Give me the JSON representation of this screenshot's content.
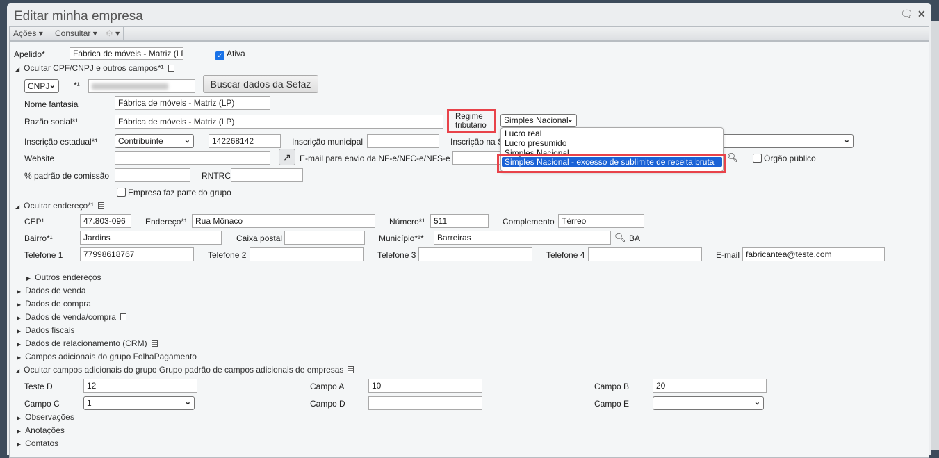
{
  "window": {
    "title": "Editar minha empresa"
  },
  "toolbar": {
    "acoes": "Ações",
    "consultar": "Consultar"
  },
  "form": {
    "apelido_label": "Apelido*",
    "apelido_value": "Fábrica de móveis - Matriz (LP",
    "ativa_label": "Ativa",
    "sec_cpf": "Ocultar CPF/CNPJ e outros campos*¹",
    "doc_type": "CNPJ",
    "doc_req": "*¹",
    "buscar_sefaz": "Buscar dados da Sefaz",
    "nome_fantasia_label": "Nome fantasia",
    "nome_fantasia_value": "Fábrica de móveis - Matriz (LP)",
    "razao_social_label": "Razão social*¹",
    "razao_social_value": "Fábrica de móveis - Matriz (LP)",
    "regime_label": "Regime tributário",
    "regime_value": "Simples Nacional",
    "ie_label": "Inscrição estadual*¹",
    "ie_type": "Contribuinte",
    "ie_value": "142268142",
    "im_label": "Inscrição municipal",
    "insc_s_label": "Inscrição na S",
    "website_label": "Website",
    "email_nfe_label": "E-mail para envio da NF-e/NFC-e/NFS-e",
    "orgao_publico_label": "Órgão público",
    "comissao_label": "% padrão de comissão",
    "rntrc_label": "RNTRC",
    "grupo_label": "Empresa faz parte do grupo"
  },
  "regime_options": [
    "Lucro real",
    "Lucro presumido",
    "Simples Nacional",
    "Simples Nacional - excesso de sublimite de receita bruta"
  ],
  "address": {
    "sec": "Ocultar endereço*¹",
    "cep_label": "CEP¹",
    "cep": "47.803-096",
    "endereco_label": "Endereço*¹",
    "endereco": "Rua Mônaco",
    "numero_label": "Número*¹",
    "numero": "511",
    "complemento_label": "Complemento",
    "complemento": "Térreo",
    "bairro_label": "Bairro*¹",
    "bairro": "Jardins",
    "caixa_label": "Caixa postal",
    "municipio_label": "Município*¹*",
    "municipio": "Barreiras",
    "uf": "BA",
    "tel1_label": "Telefone 1",
    "tel1": "77998618767",
    "tel2_label": "Telefone 2",
    "tel3_label": "Telefone 3",
    "tel4_label": "Telefone 4",
    "email_label": "E-mail",
    "email": "fabricantea@teste.com",
    "outros": "Outros endereços"
  },
  "sections": [
    "Dados de venda",
    "Dados de compra",
    "Dados de venda/compra",
    "Dados fiscais",
    "Dados de relacionamento (CRM)",
    "Campos adicionais do grupo FolhaPagamento",
    "Ocultar campos adicionais do grupo Grupo padrão de campos adicionais de empresas"
  ],
  "extra": {
    "teste_d_label": "Teste D",
    "teste_d": "12",
    "campo_a_label": "Campo A",
    "campo_a": "10",
    "campo_b_label": "Campo B",
    "campo_b": "20",
    "campo_c_label": "Campo C",
    "campo_c": "1",
    "campo_d_label": "Campo D",
    "campo_e_label": "Campo E"
  },
  "bottom_sections": [
    "Observações",
    "Anotações",
    "Contatos"
  ]
}
